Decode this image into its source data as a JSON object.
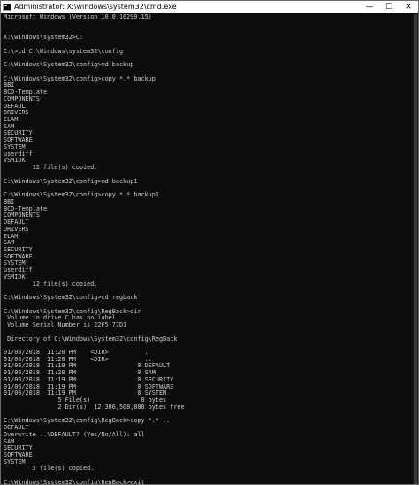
{
  "window": {
    "title": "Administrator: X:\\windows\\system32\\cmd.exe",
    "icon": "cmd-icon",
    "controls": {
      "minimize": "—",
      "maximize": "☐",
      "close": "✕"
    }
  },
  "console": {
    "lines": [
      "Microsoft Windows [Version 10.0.16299.15]",
      "",
      "",
      "X:\\windows\\system32>C:",
      "",
      "C:\\>cd C:\\Windows\\system32\\config",
      "",
      "C:\\Windows\\System32\\config>md backup",
      "",
      "C:\\Windows\\System32\\config>copy *.* backup",
      "BBI",
      "BCD-Template",
      "COMPONENTS",
      "DEFAULT",
      "DRIVERS",
      "ELAM",
      "SAM",
      "SECURITY",
      "SOFTWARE",
      "SYSTEM",
      "userdiff",
      "VSMIDK",
      "        12 file(s) copied.",
      "",
      "C:\\Windows\\System32\\config>md backup1",
      "",
      "C:\\Windows\\System32\\config>copy *.* backup1",
      "BBI",
      "BCD-Template",
      "COMPONENTS",
      "DEFAULT",
      "DRIVERS",
      "ELAM",
      "SAM",
      "SECURITY",
      "SOFTWARE",
      "SYSTEM",
      "userdiff",
      "VSMIDK",
      "        12 file(s) copied.",
      "",
      "C:\\Windows\\System32\\config>cd regback",
      "",
      "C:\\Windows\\System32\\config\\RegBack>dir",
      " Volume in drive C has no label.",
      " Volume Serial Number is 22F5-77D1",
      "",
      " Directory of C:\\Windows\\System32\\config\\RegBack",
      "",
      "01/06/2018  11:20 PM    <DIR>          .",
      "01/06/2018  11:20 PM    <DIR>          ..",
      "01/06/2018  11:19 PM                 0 DEFAULT",
      "01/06/2018  11:20 PM                 0 SAM",
      "01/06/2018  11:19 PM                 0 SECURITY",
      "01/06/2018  11:19 PM                 0 SOFTWARE",
      "01/06/2018  11:19 PM                 0 SYSTEM",
      "               5 File(s)              0 bytes",
      "               2 Dir(s)  12,386,508,800 bytes free",
      "",
      "C:\\Windows\\System32\\config\\RegBack>copy *.* ..",
      "DEFAULT",
      "Overwrite ..\\DEFAULT? (Yes/No/All): all",
      "SAM",
      "SECURITY",
      "SOFTWARE",
      "SYSTEM",
      "        5 file(s) copied.",
      "",
      "C:\\Windows\\System32\\config\\RegBack>exit"
    ]
  },
  "colors": {
    "background": "#0c0c0c",
    "text": "#cccccc",
    "titlebar": "#ffffff"
  }
}
